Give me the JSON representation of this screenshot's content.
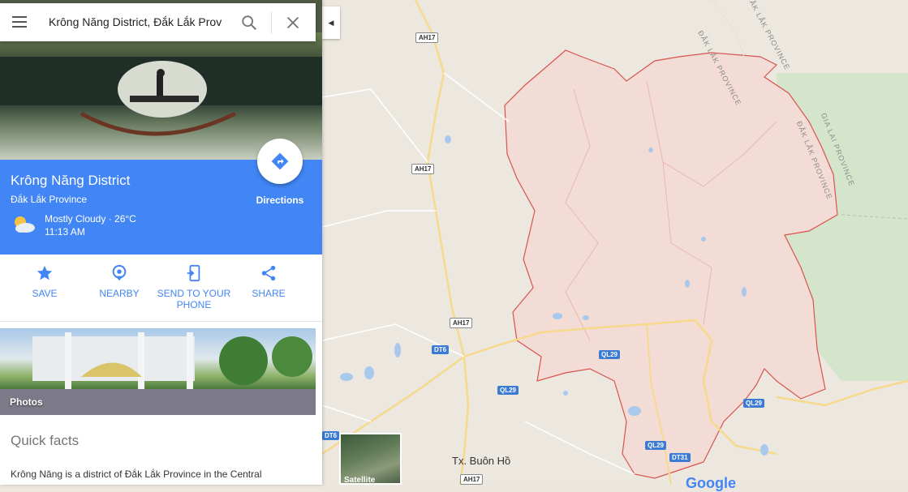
{
  "search": {
    "value": "Krông Năng District, Đắk Lắk Prov"
  },
  "place": {
    "name": "Krông Năng District",
    "region": "Đắk Lắk Province",
    "weather_line1": "Mostly Cloudy · 26°C",
    "weather_line2": "11:13 AM",
    "directions_label": "Directions"
  },
  "actions": [
    {
      "label": "SAVE",
      "icon": "star-icon"
    },
    {
      "label": "NEARBY",
      "icon": "nearby-pin-icon"
    },
    {
      "label": "SEND TO YOUR PHONE",
      "line1": "SEND TO YOUR",
      "line2": "PHONE",
      "icon": "send-to-phone-icon"
    },
    {
      "label": "SHARE",
      "icon": "share-icon"
    }
  ],
  "photos_label": "Photos",
  "quick_facts": {
    "heading": "Quick facts",
    "text": "Krông Năng is a district of Đắk Lắk Province in the Central"
  },
  "map": {
    "road_labels": [
      {
        "text": "AH17"
      },
      {
        "text": "AH17"
      },
      {
        "text": "AH17"
      },
      {
        "text": "AH17"
      },
      {
        "text": "DT6"
      },
      {
        "text": "DT6"
      },
      {
        "text": "QL29"
      },
      {
        "text": "QL29"
      },
      {
        "text": "QL29"
      },
      {
        "text": "QL29"
      },
      {
        "text": "DT31"
      }
    ],
    "places": [
      {
        "text": "Tx. Buôn Hồ"
      }
    ],
    "province_labels": [
      {
        "text": "ĐẮK LẮK PROVINCE"
      },
      {
        "text": "GIA LAI PROVINCE"
      },
      {
        "text": "ĐẮK LẮK PROVINCE"
      },
      {
        "text": "ĐẮK LẮK PROVINCE"
      }
    ],
    "satellite_label": "Satellite",
    "attribution": "Google",
    "colors": {
      "district_fill": "#f3dcd6",
      "district_border": "#d9534f",
      "water": "#a9c9ec",
      "road": "#f6d98a",
      "park": "#cfe3c4"
    }
  }
}
